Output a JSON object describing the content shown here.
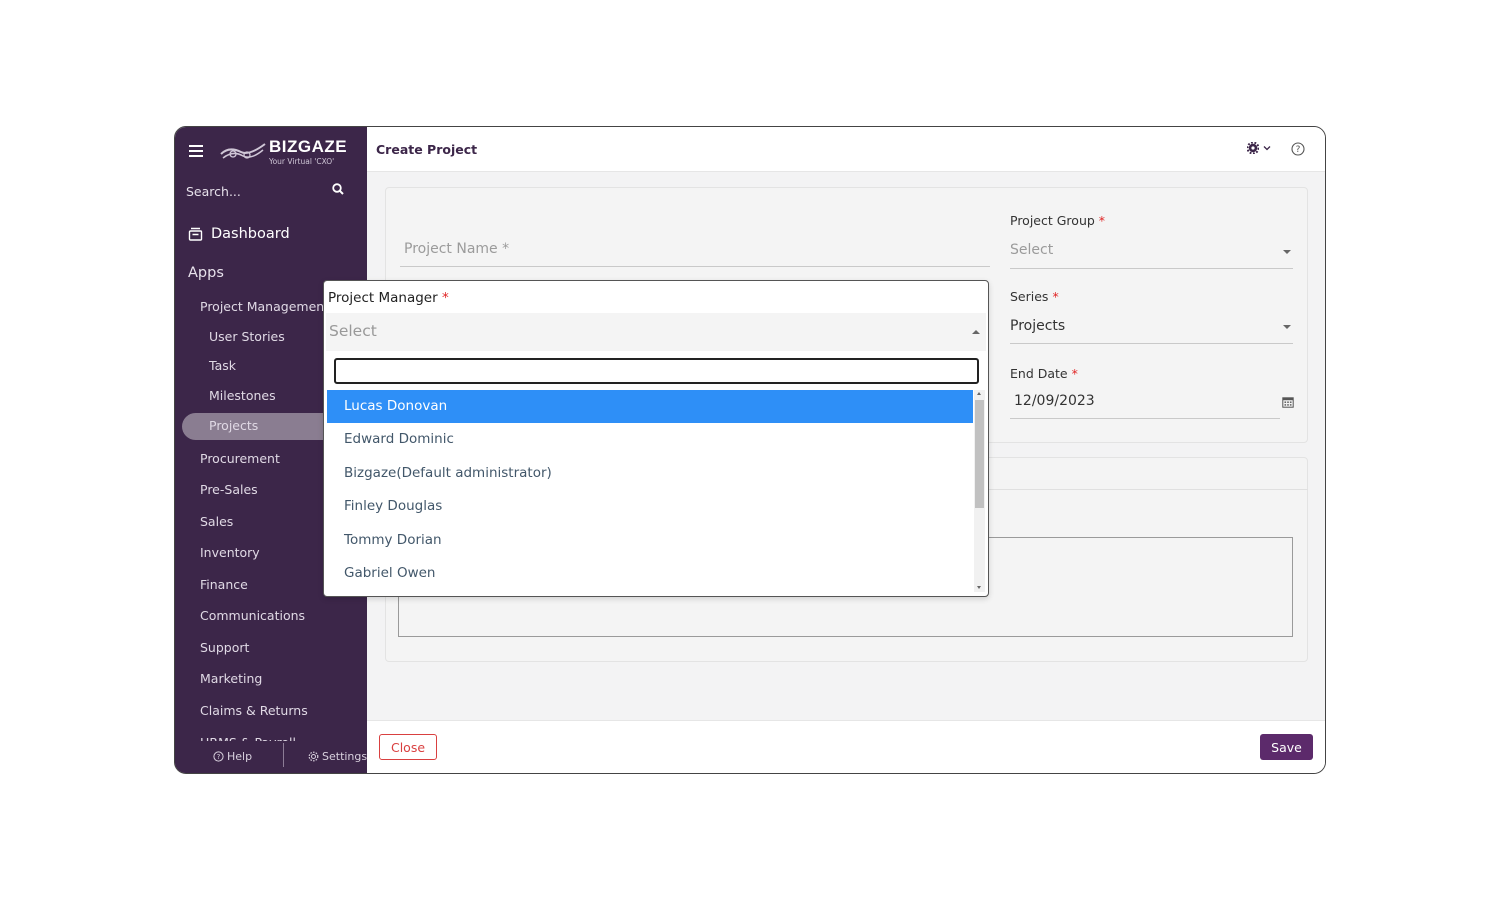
{
  "sidebar": {
    "logo_text": "BIZGAZE",
    "logo_tagline": "Your Virtual 'CXO'",
    "search_placeholder": "Search...",
    "dashboard_label": "Dashboard",
    "apps_label": "Apps",
    "project_management_label": "Project Management",
    "sub_items": [
      "User Stories",
      "Task",
      "Milestones",
      "Projects"
    ],
    "active_item": "Projects",
    "items": [
      "Procurement",
      "Pre-Sales",
      "Sales",
      "Inventory",
      "Finance",
      "Communications",
      "Support",
      "Marketing",
      "Claims & Returns"
    ],
    "cut_item": "HRMS & Payroll",
    "help_label": "Help",
    "settings_label": "Settings"
  },
  "header": {
    "title": "Create Project",
    "settings_icon": "gear-icon",
    "help_icon": "question-circle-icon"
  },
  "form": {
    "project_name_placeholder": "Project Name *",
    "project_group_label": "Project Group",
    "project_group_value": "Select",
    "series_label": "Series",
    "series_value": "Projects",
    "end_date_label": "End Date",
    "end_date_value": "12/09/2023",
    "required_marker": "*"
  },
  "project_manager_dropdown": {
    "label": "Project Manager",
    "selected_placeholder": "Select",
    "search_value": "",
    "options": [
      "Lucas Donovan",
      "Edward Dominic",
      "Bizgaze(Default administrator)",
      "Finley Douglas",
      "Tommy Dorian",
      "Gabriel Owen"
    ],
    "highlighted_index": 0
  },
  "footer": {
    "close_label": "Close",
    "save_label": "Save"
  },
  "colors": {
    "sidebar_bg": "#3c2649",
    "accent": "#5c2a6b",
    "highlight": "#2e8ff7",
    "close": "#d94040"
  }
}
